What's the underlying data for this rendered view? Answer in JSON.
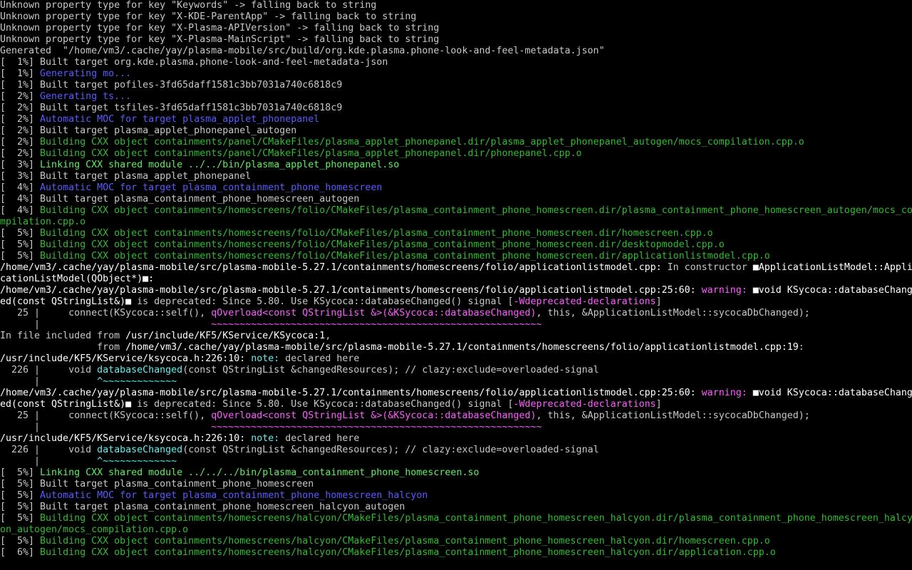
{
  "terminal": {
    "colors": {
      "background": "#000000",
      "text": "#c8c8c8",
      "generating": "#5a5aff",
      "building": "#2ebd2e",
      "linking": "#5cf05c",
      "warning": "#ff5cff",
      "note": "#5cf0f0"
    },
    "lines": [
      [
        {
          "t": "Unknown property type for key \"Keywords\" -> falling back to string",
          "c": "plain"
        }
      ],
      [
        {
          "t": "Unknown property type for key \"X-KDE-ParentApp\" -> falling back to string",
          "c": "plain"
        }
      ],
      [
        {
          "t": "Unknown property type for key \"X-Plasma-APIVersion\" -> falling back to string",
          "c": "plain"
        }
      ],
      [
        {
          "t": "Unknown property type for key \"X-Plasma-MainScript\" -> falling back to string",
          "c": "plain"
        }
      ],
      [
        {
          "t": "Generated  \"/home/vm3/.cache/yay/plasma-mobile/src/build/org.kde.plasma.phone-look-and-feel-metadata.json\"",
          "c": "plain"
        }
      ],
      [
        {
          "t": "[  1%] Built target org.kde.plasma.phone-look-and-feel-metadata-json",
          "c": "plain"
        }
      ],
      [
        {
          "t": "[  1%] ",
          "c": "plain"
        },
        {
          "t": "Generating mo...",
          "c": "blue"
        }
      ],
      [
        {
          "t": "[  1%] Built target pofiles-3fd65daff1581c3bb7031a740c6818c9",
          "c": "plain"
        }
      ],
      [
        {
          "t": "[  2%] ",
          "c": "plain"
        },
        {
          "t": "Generating ts...",
          "c": "blue"
        }
      ],
      [
        {
          "t": "[  2%] Built target tsfiles-3fd65daff1581c3bb7031a740c6818c9",
          "c": "plain"
        }
      ],
      [
        {
          "t": "[  2%] ",
          "c": "plain"
        },
        {
          "t": "Automatic MOC for target plasma_applet_phonepanel",
          "c": "blue"
        }
      ],
      [
        {
          "t": "[  2%] Built target plasma_applet_phonepanel_autogen",
          "c": "plain"
        }
      ],
      [
        {
          "t": "[  2%] ",
          "c": "plain"
        },
        {
          "t": "Building CXX object containments/panel/CMakeFiles/plasma_applet_phonepanel.dir/plasma_applet_phonepanel_autogen/mocs_compilation.cpp.o",
          "c": "green"
        }
      ],
      [
        {
          "t": "[  2%] ",
          "c": "plain"
        },
        {
          "t": "Building CXX object containments/panel/CMakeFiles/plasma_applet_phonepanel.dir/phonepanel.cpp.o",
          "c": "green"
        }
      ],
      [
        {
          "t": "[  3%] ",
          "c": "plain"
        },
        {
          "t": "Linking CXX shared module ../../bin/plasma_applet_phonepanel.so",
          "c": "bgreen"
        }
      ],
      [
        {
          "t": "[  3%] Built target plasma_applet_phonepanel",
          "c": "plain"
        }
      ],
      [
        {
          "t": "[  4%] ",
          "c": "plain"
        },
        {
          "t": "Automatic MOC for target plasma_containment_phone_homescreen",
          "c": "blue"
        }
      ],
      [
        {
          "t": "[  4%] Built target plasma_containment_phone_homescreen_autogen",
          "c": "plain"
        }
      ],
      [
        {
          "t": "[  4%] ",
          "c": "plain"
        },
        {
          "t": "Building CXX object containments/homescreens/folio/CMakeFiles/plasma_containment_phone_homescreen.dir/plasma_containment_phone_homescreen_autogen/mocs_co",
          "c": "green"
        }
      ],
      [
        {
          "t": "mpilation.cpp.o",
          "c": "green"
        }
      ],
      [
        {
          "t": "[  5%] ",
          "c": "plain"
        },
        {
          "t": "Building CXX object containments/homescreens/folio/CMakeFiles/plasma_containment_phone_homescreen.dir/homescreen.cpp.o",
          "c": "green"
        }
      ],
      [
        {
          "t": "[  5%] ",
          "c": "plain"
        },
        {
          "t": "Building CXX object containments/homescreens/folio/CMakeFiles/plasma_containment_phone_homescreen.dir/desktopmodel.cpp.o",
          "c": "green"
        }
      ],
      [
        {
          "t": "[  5%] ",
          "c": "plain"
        },
        {
          "t": "Building CXX object containments/homescreens/folio/CMakeFiles/plasma_containment_phone_homescreen.dir/applicationlistmodel.cpp.o",
          "c": "green"
        }
      ],
      [
        {
          "t": "/home/vm3/.cache/yay/plasma-mobile/src/plasma-mobile-5.27.1/containments/homescreens/folio/applicationlistmodel.cpp:",
          "c": "white"
        },
        {
          "t": " In constructor ",
          "c": "plain"
        },
        {
          "t": "■ApplicationListModel::Appli",
          "c": "white"
        }
      ],
      [
        {
          "t": "cationListModel(QObject*)■:",
          "c": "white"
        }
      ],
      [
        {
          "t": "/home/vm3/.cache/yay/plasma-mobile/src/plasma-mobile-5.27.1/containments/homescreens/folio/applicationlistmodel.cpp:25:60:",
          "c": "white"
        },
        {
          "t": " warning:",
          "c": "magenta"
        },
        {
          "t": " ■void KSycoca::databaseChang",
          "c": "white"
        }
      ],
      [
        {
          "t": "ed(const QStringList&)■",
          "c": "white"
        },
        {
          "t": " is deprecated: Since 5.80. Use KSycoca::databaseChanged() signal [",
          "c": "plain"
        },
        {
          "t": "-Wdeprecated-declarations",
          "c": "magenta"
        },
        {
          "t": "]",
          "c": "plain"
        }
      ],
      [
        {
          "t": "   25 |     connect(KSycoca::self(), ",
          "c": "plain"
        },
        {
          "t": "qOverload<const QStringList &>(&KSycoca::databaseChanged)",
          "c": "magenta"
        },
        {
          "t": ", this, &ApplicationListModel::sycocaDbChanged);",
          "c": "plain"
        }
      ],
      [
        {
          "t": "      |                              ",
          "c": "plain"
        },
        {
          "t": "~~~~~~~~~~~~~~~~~~~~~~~~~~~~~~~~~~~~~~~~~~~~~~~~~~~~~~~~~~",
          "c": "magenta"
        }
      ],
      [
        {
          "t": "In file included from ",
          "c": "plain"
        },
        {
          "t": "/usr/include/KF5/KService/KSycoca:1",
          "c": "white"
        },
        {
          "t": ",",
          "c": "plain"
        }
      ],
      [
        {
          "t": "                 from ",
          "c": "plain"
        },
        {
          "t": "/home/vm3/.cache/yay/plasma-mobile/src/plasma-mobile-5.27.1/containments/homescreens/folio/applicationlistmodel.cpp:19",
          "c": "white"
        },
        {
          "t": ":",
          "c": "plain"
        }
      ],
      [
        {
          "t": "/usr/include/KF5/KService/ksycoca.h:226:10:",
          "c": "white"
        },
        {
          "t": " note:",
          "c": "cyan"
        },
        {
          "t": " declared here",
          "c": "plain"
        }
      ],
      [
        {
          "t": "  226 |     void ",
          "c": "plain"
        },
        {
          "t": "databaseChanged",
          "c": "cyan"
        },
        {
          "t": "(const QStringList &changedResources); // clazy:exclude=overloaded-signal",
          "c": "plain"
        }
      ],
      [
        {
          "t": "      |          ",
          "c": "plain"
        },
        {
          "t": "^~~~~~~~~~~~~~",
          "c": "cyan"
        }
      ],
      [
        {
          "t": "/home/vm3/.cache/yay/plasma-mobile/src/plasma-mobile-5.27.1/containments/homescreens/folio/applicationlistmodel.cpp:25:60:",
          "c": "white"
        },
        {
          "t": " warning:",
          "c": "magenta"
        },
        {
          "t": " ■void KSycoca::databaseChang",
          "c": "white"
        }
      ],
      [
        {
          "t": "ed(const QStringList&)■",
          "c": "white"
        },
        {
          "t": " is deprecated: Since 5.80. Use KSycoca::databaseChanged() signal [",
          "c": "plain"
        },
        {
          "t": "-Wdeprecated-declarations",
          "c": "magenta"
        },
        {
          "t": "]",
          "c": "plain"
        }
      ],
      [
        {
          "t": "   25 |     connect(KSycoca::self(), ",
          "c": "plain"
        },
        {
          "t": "qOverload<const QStringList &>(&KSycoca::databaseChanged)",
          "c": "magenta"
        },
        {
          "t": ", this, &ApplicationListModel::sycocaDbChanged);",
          "c": "plain"
        }
      ],
      [
        {
          "t": "      |                              ",
          "c": "plain"
        },
        {
          "t": "~~~~~~~~~~~~~~~~~~~~~~~~~~~~~~~~~~~~~~~~~~~~~~~~~~~~~~~~~~",
          "c": "magenta"
        }
      ],
      [
        {
          "t": "/usr/include/KF5/KService/ksycoca.h:226:10:",
          "c": "white"
        },
        {
          "t": " note:",
          "c": "cyan"
        },
        {
          "t": " declared here",
          "c": "plain"
        }
      ],
      [
        {
          "t": "  226 |     void ",
          "c": "plain"
        },
        {
          "t": "databaseChanged",
          "c": "cyan"
        },
        {
          "t": "(const QStringList &changedResources); // clazy:exclude=overloaded-signal",
          "c": "plain"
        }
      ],
      [
        {
          "t": "      |          ",
          "c": "plain"
        },
        {
          "t": "^~~~~~~~~~~~~~",
          "c": "cyan"
        }
      ],
      [
        {
          "t": "[  5%] ",
          "c": "plain"
        },
        {
          "t": "Linking CXX shared module ../../../bin/plasma_containment_phone_homescreen.so",
          "c": "bgreen"
        }
      ],
      [
        {
          "t": "[  5%] Built target plasma_containment_phone_homescreen",
          "c": "plain"
        }
      ],
      [
        {
          "t": "[  5%] ",
          "c": "plain"
        },
        {
          "t": "Automatic MOC for target plasma_containment_phone_homescreen_halcyon",
          "c": "blue"
        }
      ],
      [
        {
          "t": "[  5%] Built target plasma_containment_phone_homescreen_halcyon_autogen",
          "c": "plain"
        }
      ],
      [
        {
          "t": "[  5%] ",
          "c": "plain"
        },
        {
          "t": "Building CXX object containments/homescreens/halcyon/CMakeFiles/plasma_containment_phone_homescreen_halcyon.dir/plasma_containment_phone_homescreen_halcy",
          "c": "green"
        }
      ],
      [
        {
          "t": "on_autogen/mocs_compilation.cpp.o",
          "c": "green"
        }
      ],
      [
        {
          "t": "[  5%] ",
          "c": "plain"
        },
        {
          "t": "Building CXX object containments/homescreens/halcyon/CMakeFiles/plasma_containment_phone_homescreen_halcyon.dir/homescreen.cpp.o",
          "c": "green"
        }
      ],
      [
        {
          "t": "[  6%] ",
          "c": "plain"
        },
        {
          "t": "Building CXX object containments/homescreens/halcyon/CMakeFiles/plasma_containment_phone_homescreen_halcyon.dir/application.cpp.o",
          "c": "green"
        }
      ]
    ]
  }
}
